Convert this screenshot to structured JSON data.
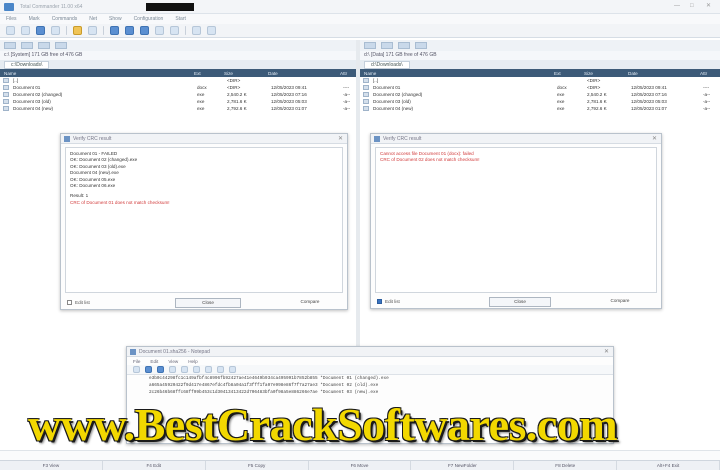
{
  "window": {
    "title": "Total Commander 11.00 x64"
  },
  "menu": [
    "Files",
    "Mark",
    "Commands",
    "Net",
    "Show",
    "Configuration",
    "Start"
  ],
  "left_panel": {
    "path": "c:\\  [System]  171 GB free of 476 GB",
    "tab": "c:\\Downloads\\",
    "columns": [
      "Name",
      "Ext",
      "Size",
      "Date",
      "Attr"
    ],
    "rows": [
      [
        "[..]",
        "",
        "<DIR>",
        "",
        ""
      ],
      [
        "Document 01",
        "docx",
        "<DIR>",
        "12/05/2023 09:41",
        "----"
      ],
      [
        "Document 02 (changed)",
        "exe",
        "2,540.2 K",
        "12/05/2023 07:16",
        "-a--"
      ],
      [
        "Document 03 (old)",
        "exe",
        "2,781.6 K",
        "12/05/2023 05:03",
        "-a--"
      ],
      [
        "Document 04 (new)",
        "exe",
        "2,792.6 K",
        "12/05/2023 01:07",
        "-a--"
      ]
    ]
  },
  "right_panel": {
    "path": "d:\\  [Data]  171 GB free of 476 GB",
    "tab": "d:\\Downloads\\",
    "columns": [
      "Name",
      "Ext",
      "Size",
      "Date",
      "Attr"
    ],
    "rows": [
      [
        "[..]",
        "",
        "<DIR>",
        "",
        ""
      ],
      [
        "Document 01",
        "docx",
        "<DIR>",
        "12/05/2023 09:41",
        "----"
      ],
      [
        "Document 02 (changed)",
        "exe",
        "2,540.2 K",
        "12/05/2023 07:16",
        "-a--"
      ],
      [
        "Document 03 (old)",
        "exe",
        "2,781.6 K",
        "12/05/2023 05:03",
        "-a--"
      ],
      [
        "Document 04 (new)",
        "exe",
        "2,792.6 K",
        "12/05/2023 01:07",
        "-a--"
      ]
    ]
  },
  "dialog_left": {
    "title": "Verify CRC result",
    "lines": [
      "Document 01 - FAILED",
      "OK: Document 02 (changed).exe",
      "OK: Document 03 (old).exe",
      "Document 04 (new).exe",
      "OK: Document 05.exe",
      "OK: Document 06.exe"
    ],
    "summary_label": "Result: 1",
    "error_line": "CRC of Document 01 does not match checksum!",
    "checkbox": "Edit list",
    "ok": "Close",
    "extra": "Compare"
  },
  "dialog_right": {
    "title": "Verify CRC result",
    "lines": [
      "Cannot access file Document 01 (docx): failed",
      "CRC of Document 02 does not match checksum!"
    ],
    "checkbox": "Edit list",
    "ok": "Close",
    "extra": "Compare"
  },
  "editor": {
    "title": "Document 01.sha256 - Notepad",
    "menu": [
      "File",
      "Edit",
      "View",
      "Help"
    ],
    "lines": [
      "e3b0c44298fc1c149afbf4c8996fb92427ae41e4649b934ca495991b7852b855 *Document 01 (changed).exe",
      "a665a45920422f9d417e4867efdc4fb8a04a1f3fff1fa07e998e86f7f7a27ae3 *Document 02 (old).exe",
      "2c26b46b68ffc68ff99b453c1d30413413422d706483bfa0f98a5e886266e7ae *Document 03 (new).exe"
    ]
  },
  "fkeys": [
    "F3 View",
    "F4 Edit",
    "F5 Copy",
    "F6 Move",
    "F7 NewFolder",
    "F8 Delete",
    "Alt+F4 Exit"
  ],
  "watermark": "www.BestCrackSoftwares.com"
}
